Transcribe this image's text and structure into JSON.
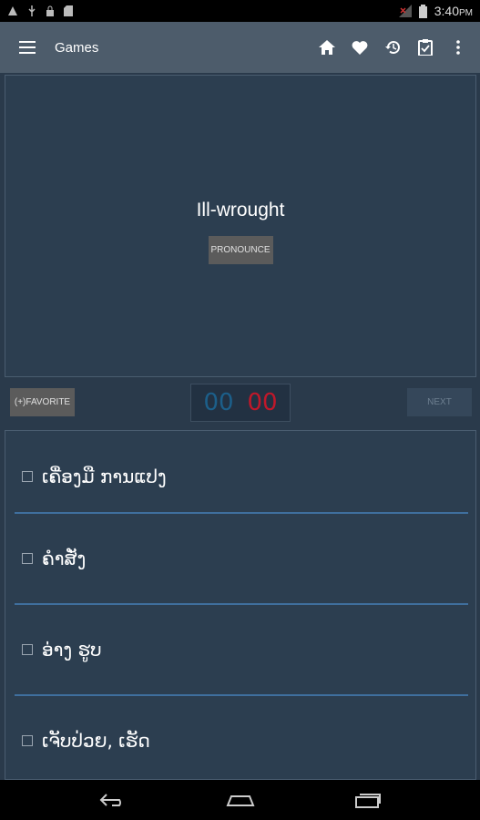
{
  "status_bar": {
    "time": "3:40",
    "time_suffix": "PM",
    "icons": [
      "warning-icon",
      "usb-icon",
      "lock-icon",
      "sd-card-icon",
      "signal-icon",
      "battery-icon"
    ]
  },
  "app_bar": {
    "title": "Games",
    "actions": [
      "home-icon",
      "heart-icon",
      "history-icon",
      "clipboard-icon",
      "more-icon"
    ]
  },
  "word_card": {
    "word": "Ill-wrought",
    "pronounce_label": "PRONOUNCE"
  },
  "controls": {
    "favorite_label": "(+)FAVORITE",
    "score_correct": "00",
    "score_wrong": "00",
    "next_label": "NEXT"
  },
  "options": [
    {
      "text": "ເຄື່ອງມື ການແປງ"
    },
    {
      "text": "ຄໍາສັ່ງ"
    },
    {
      "text": "ອ່າງ ຮູບ"
    },
    {
      "text": "ເຈັບປ່ວຍ, ເຮັດ"
    }
  ],
  "colors": {
    "background": "#2a3a4b",
    "app_bar": "#4d5c6b",
    "score_blue": "#1c5f8a",
    "score_red": "#c0182a",
    "divider": "#3f6f9e"
  }
}
